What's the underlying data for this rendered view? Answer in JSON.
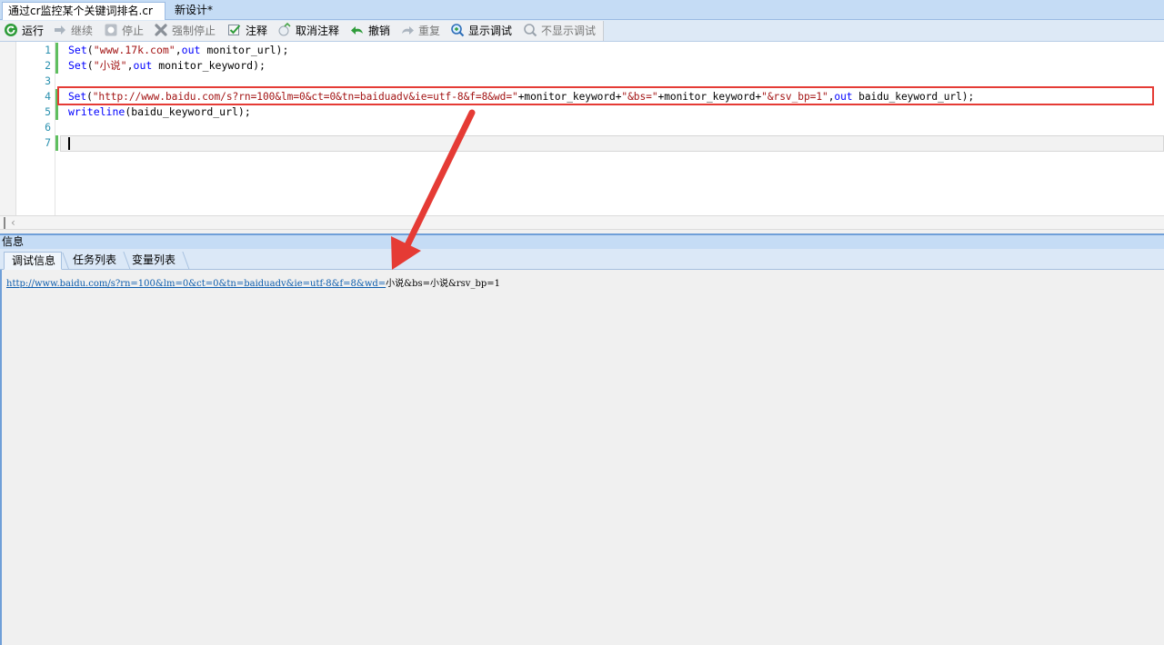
{
  "doc_tabs": [
    {
      "label": "通过cr监控某个关键词排名.cr"
    },
    {
      "label": "新设计*"
    }
  ],
  "toolbar": {
    "run": "运行",
    "continue": "继续",
    "stop": "停止",
    "force_stop": "强制停止",
    "comment": "注释",
    "uncomment": "取消注释",
    "undo": "撤销",
    "redo": "重复",
    "show_debug": "显示调试",
    "hide_debug": "不显示调试"
  },
  "editor": {
    "line_numbers": [
      "1",
      "2",
      "3",
      "4",
      "5",
      "6",
      "7"
    ],
    "lines": {
      "l1": {
        "fn": "Set",
        "open": "(",
        "s1": "\"www.17k.com\"",
        "comma": ",",
        "out": "out",
        "rest": " monitor_url);"
      },
      "l2": {
        "fn": "Set",
        "open": "(",
        "s1": "\"小说\"",
        "comma": ",",
        "out": "out",
        "rest": " monitor_keyword);"
      },
      "l4": {
        "fn": "Set",
        "open": "(",
        "s1": "\"http://www.baidu.com/s?rn=100&lm=0&ct=0&tn=baiduadv&ie=utf-8&f=8&wd=\"",
        "p1": "+monitor_keyword+",
        "s2": "\"&bs=\"",
        "p2": "+monitor_keyword+",
        "s3": "\"&rsv_bp=1\"",
        "comma": ",",
        "out": "out",
        "rest": " baidu_keyword_url);"
      },
      "l5": {
        "fn": "writeline",
        "rest": "(baidu_keyword_url);"
      }
    }
  },
  "info": {
    "header": "信息",
    "tabs": [
      "调试信息",
      "任务列表",
      "变量列表"
    ],
    "output_link": "http://www.baidu.com/s?rn=100&lm=0&ct=0&tn=baiduadv&ie=utf-8&f=8&wd=",
    "output_rest": "小说&bs=小说&rsv_bp=1"
  },
  "colors": {
    "keyword": "#0000ff",
    "string": "#a31515",
    "line_number": "#2b91af",
    "annotation": "#e53b35"
  }
}
